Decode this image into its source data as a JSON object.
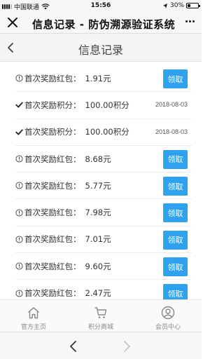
{
  "status_bar": {
    "carrier": "中国联通",
    "time": "15:56",
    "battery_text": "30%",
    "battery_level": 0.3
  },
  "wechat_bar": {
    "title": "信息记录 - 防伪溯源验证系统"
  },
  "header": {
    "title": "信息记录"
  },
  "records": [
    {
      "icon": "info-circle-icon",
      "label": "首次奖励红包：",
      "value": "1.91元",
      "action": "领取",
      "date": ""
    },
    {
      "icon": "check-icon",
      "label": "首次奖励积分：",
      "value": "100.00积分",
      "action": "",
      "date": "2018-08-03"
    },
    {
      "icon": "check-icon",
      "label": "首次奖励积分：",
      "value": "100.00积分",
      "action": "",
      "date": "2018-08-03"
    },
    {
      "icon": "info-circle-icon",
      "label": "首次奖励红包：",
      "value": "8.68元",
      "action": "领取",
      "date": ""
    },
    {
      "icon": "info-circle-icon",
      "label": "首次奖励红包：",
      "value": "5.77元",
      "action": "领取",
      "date": ""
    },
    {
      "icon": "info-circle-icon",
      "label": "首次奖励红包：",
      "value": "7.98元",
      "action": "领取",
      "date": ""
    },
    {
      "icon": "info-circle-icon",
      "label": "首次奖励红包：",
      "value": "7.01元",
      "action": "领取",
      "date": ""
    },
    {
      "icon": "info-circle-icon",
      "label": "首次奖励红包：",
      "value": "9.60元",
      "action": "领取",
      "date": ""
    },
    {
      "icon": "info-circle-icon",
      "label": "首次奖励红包：",
      "value": "2.47元",
      "action": "领取",
      "date": ""
    }
  ],
  "tabbar": {
    "items": [
      {
        "icon": "home-icon",
        "label": "官方主页"
      },
      {
        "icon": "cart-icon",
        "label": "积分商城"
      },
      {
        "icon": "user-icon",
        "label": "会员中心"
      }
    ]
  },
  "colors": {
    "accent": "#2ea2ef"
  }
}
